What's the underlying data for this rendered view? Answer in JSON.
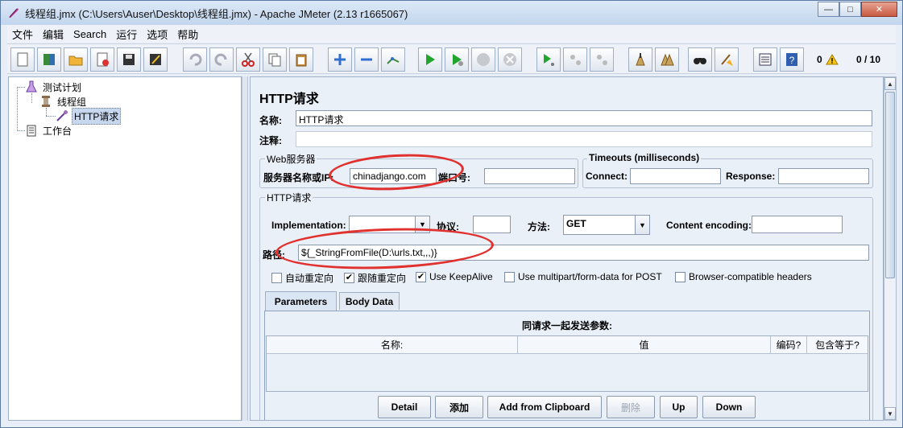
{
  "window": {
    "title": "线程组.jmx (C:\\Users\\Auser\\Desktop\\线程组.jmx) - Apache JMeter (2.13 r1665067)",
    "minimize_glyph": "—",
    "maximize_glyph": "□",
    "close_glyph": "✕"
  },
  "menu": {
    "items": [
      "文件",
      "编辑",
      "Search",
      "运行",
      "选项",
      "帮助"
    ]
  },
  "toolbar": {
    "error_count": "0",
    "threads": "0 / 10",
    "icons": [
      "new-icon",
      "templates-icon",
      "open-icon",
      "close-icon",
      "save-icon",
      "save-screenshot-icon",
      "undo-icon",
      "redo-icon",
      "cut-icon",
      "copy-icon",
      "paste-icon",
      "expand-icon",
      "collapse-icon",
      "toggle-icon",
      "start-icon",
      "start-no-pause-icon",
      "stop-icon",
      "shutdown-icon",
      "remote-start-icon",
      "remote-stop-icon",
      "remote-shutdown-icon",
      "clear-icon",
      "clear-all-icon",
      "search-icon",
      "reset-search-icon",
      "function-helper-icon",
      "help-icon"
    ]
  },
  "tree": {
    "test_plan": "测试计划",
    "thread_group": "线程组",
    "http_request": "HTTP请求",
    "workbench": "工作台"
  },
  "form": {
    "heading": "HTTP请求",
    "name_label": "名称:",
    "name_value": "HTTP请求",
    "comment_label": "注释:",
    "comment_value": "",
    "web_server": {
      "title": "Web服务器",
      "server_label": "服务器名称或IP:",
      "server_value": "chinadjango.com",
      "port_label": "端口号:",
      "port_value": ""
    },
    "timeouts": {
      "title": "Timeouts (milliseconds)",
      "connect_label": "Connect:",
      "connect_value": "",
      "response_label": "Response:",
      "response_value": ""
    },
    "http": {
      "title": "HTTP请求",
      "implementation_label": "Implementation:",
      "implementation_value": "",
      "protocol_label": "协议:",
      "protocol_value": "",
      "method_label": "方法:",
      "method_value": "GET",
      "encoding_label": "Content encoding:",
      "encoding_value": "",
      "path_label": "路径:",
      "path_value": "${_StringFromFile(D:\\urls.txt,,,)}"
    },
    "options": [
      {
        "label": "自动重定向",
        "checked": false
      },
      {
        "label": "跟随重定向",
        "checked": true
      },
      {
        "label": "Use KeepAlive",
        "checked": true
      },
      {
        "label": "Use multipart/form-data for POST",
        "checked": false
      },
      {
        "label": "Browser-compatible headers",
        "checked": false
      }
    ],
    "tabs": [
      "Parameters",
      "Body Data"
    ],
    "params": {
      "caption": "同请求一起发送参数:",
      "columns": [
        "名称:",
        "值",
        "编码?",
        "包含等于?"
      ]
    },
    "buttons": {
      "detail": "Detail",
      "add": "添加",
      "add_clipboard": "Add from Clipboard",
      "delete": "删除",
      "up": "Up",
      "down": "Down"
    }
  },
  "colors": {
    "annotation": "#e0312f",
    "selection": "#c7d7ee",
    "panel_bg": "#eaf0f8"
  }
}
